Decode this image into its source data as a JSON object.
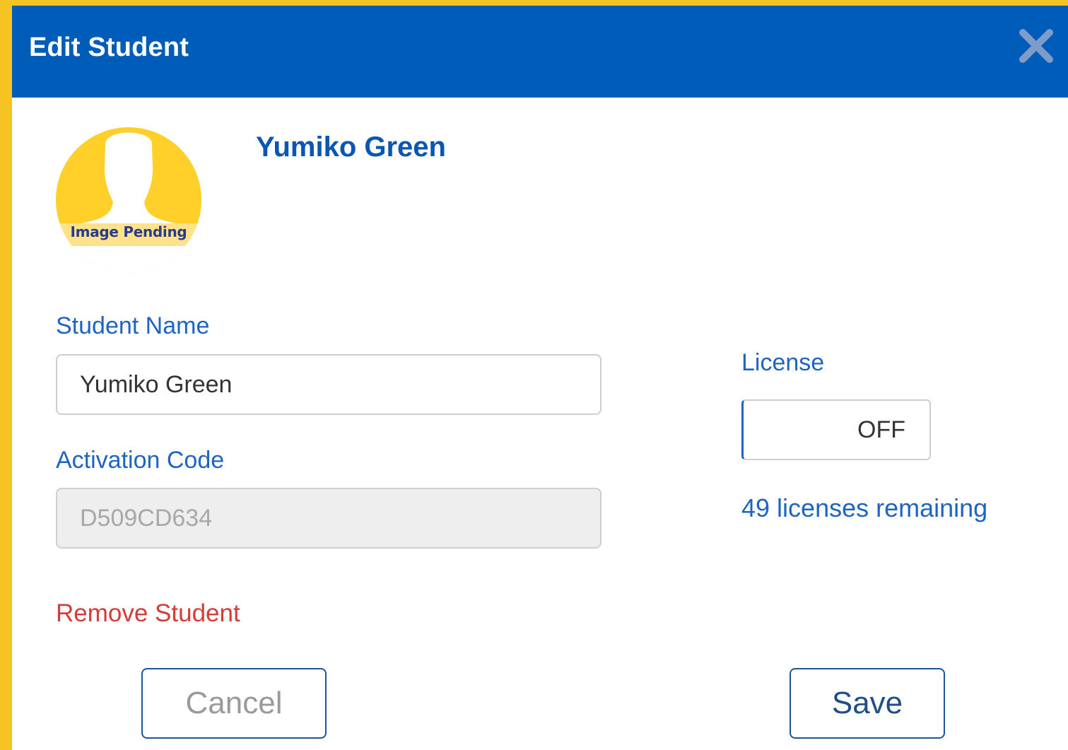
{
  "dialog": {
    "title": "Edit Student",
    "close_icon": "close-icon"
  },
  "colors": {
    "header_bg": "#005cb9",
    "accent": "#1e64c2",
    "danger": "#d33d38",
    "avatar_bg": "#ffd02a",
    "frame": "#f5c423"
  },
  "avatar": {
    "icon": "person-silhouette-icon",
    "caption": "Image Pending"
  },
  "student": {
    "display_name": "Yumiko Green"
  },
  "form": {
    "name_label": "Student Name",
    "name_value": "Yumiko Green",
    "code_label": "Activation Code",
    "code_value": "D509CD634"
  },
  "license": {
    "label": "License",
    "toggle_state": "OFF",
    "remaining_text": "49 licenses remaining"
  },
  "actions": {
    "remove_label": "Remove Student",
    "cancel_label": "Cancel",
    "save_label": "Save"
  }
}
